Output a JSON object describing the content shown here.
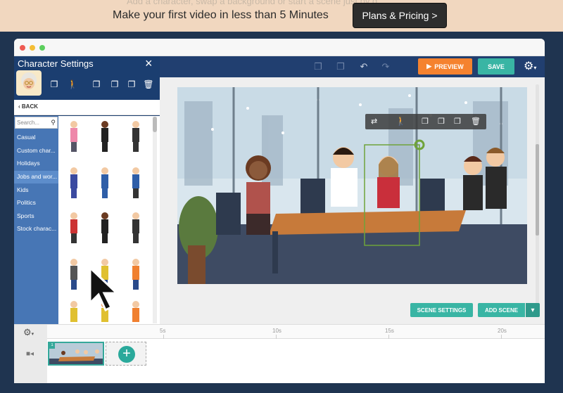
{
  "banner": {
    "ghost_text": "Add a character, swap a background or start a scene just by d",
    "text": "Make your first video in less than 5 Minutes",
    "button_label": "Plans & Pricing >"
  },
  "toolbar": {
    "preview_label": "PREVIEW",
    "save_label": "SAVE"
  },
  "panel": {
    "title": "Character Settings",
    "back_label": "BACK",
    "search_placeholder": "Search...",
    "categories": [
      "Casual",
      "Custom char...",
      "Holidays",
      "Jobs and wor...",
      "Kids",
      "Politics",
      "Sports",
      "Stock charac..."
    ],
    "active_category_index": 3
  },
  "canvas": {
    "scene_settings_label": "SCENE SETTINGS",
    "add_scene_label": "ADD SCENE"
  },
  "timeline": {
    "ticks": [
      "5s",
      "10s",
      "15s",
      "20s"
    ],
    "clip_number": "1"
  },
  "colors": {
    "accent_teal": "#39b5a4",
    "preview_orange": "#f5822f",
    "toolbar_navy": "#213f70",
    "category_blue": "#4776b5"
  }
}
